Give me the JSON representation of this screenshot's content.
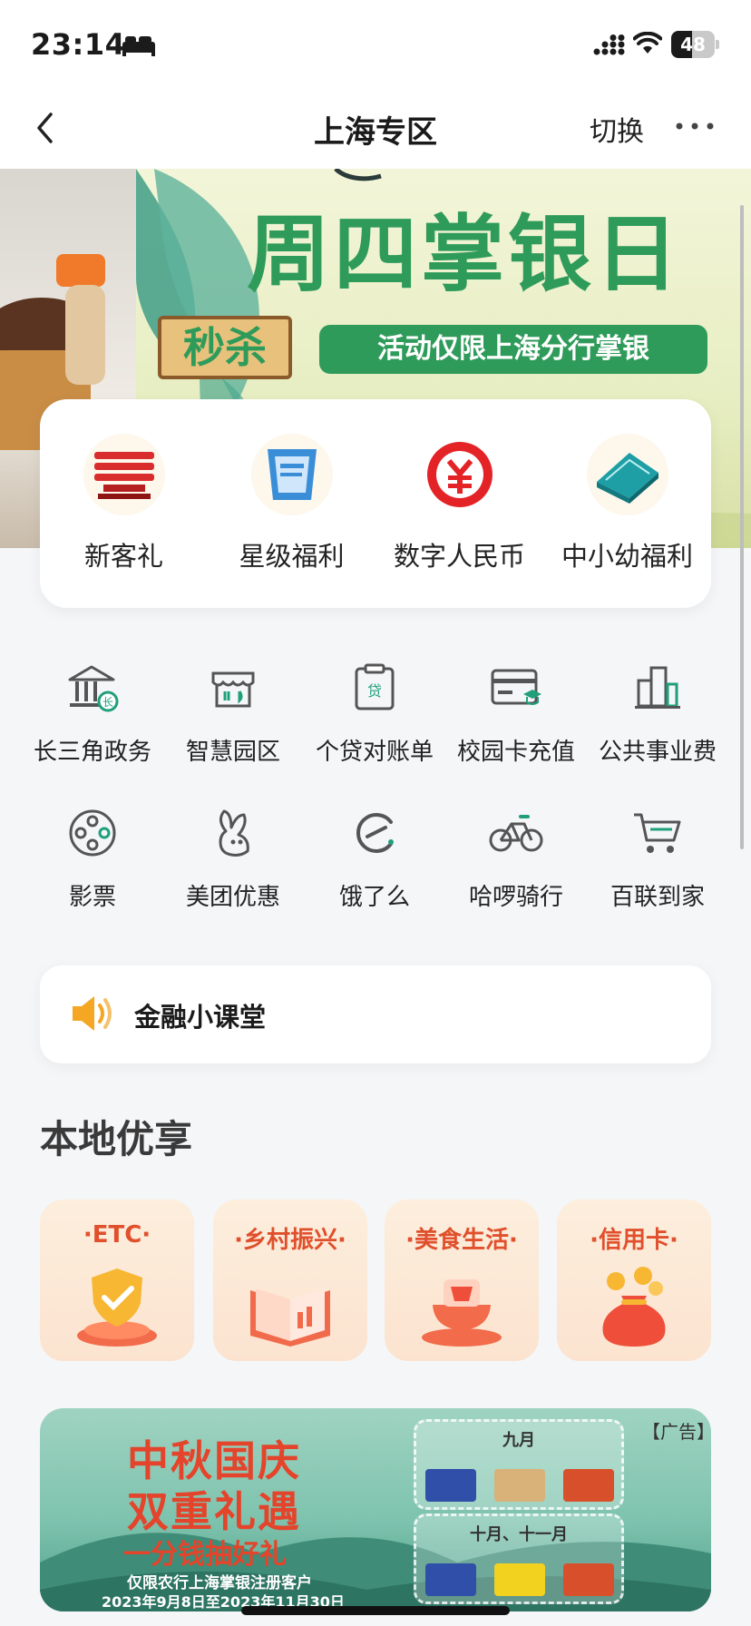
{
  "status_bar": {
    "time": "23:14",
    "battery": "48",
    "battery_level": 0.48
  },
  "nav": {
    "title": "上海专区",
    "switch_label": "切换"
  },
  "banner": {
    "headline": "周四掌银日",
    "tag_left": "秒杀",
    "tag_right": "活动仅限上海分行掌银"
  },
  "featured": [
    {
      "label": "新客礼",
      "icon": "red-building-icon"
    },
    {
      "label": "星级福利",
      "icon": "blue-card-icon"
    },
    {
      "label": "数字人民币",
      "icon": "digital-yuan-icon"
    },
    {
      "label": "中小幼福利",
      "icon": "teal-building-icon"
    }
  ],
  "services": [
    {
      "label": "长三角政务",
      "icon": "government-icon"
    },
    {
      "label": "智慧园区",
      "icon": "store-icon"
    },
    {
      "label": "个贷对账单",
      "icon": "loan-clipboard-icon"
    },
    {
      "label": "校园卡充值",
      "icon": "campus-card-icon"
    },
    {
      "label": "公共事业费",
      "icon": "utilities-building-icon"
    },
    {
      "label": "影票",
      "icon": "film-reel-icon"
    },
    {
      "label": "美团优惠",
      "icon": "kangaroo-icon"
    },
    {
      "label": "饿了么",
      "icon": "eleme-icon"
    },
    {
      "label": "哈啰骑行",
      "icon": "bicycle-icon"
    },
    {
      "label": "百联到家",
      "icon": "cart-icon"
    }
  ],
  "finance": {
    "label": "金融小课堂"
  },
  "local": {
    "title": "本地优享",
    "items": [
      {
        "label": "·ETC·"
      },
      {
        "label": "·乡村振兴·"
      },
      {
        "label": "·美食生活·"
      },
      {
        "label": "·信用卡·"
      }
    ]
  },
  "ad": {
    "tag": "【广告】",
    "title_line1": "中秋国庆",
    "title_line2": "双重礼遇",
    "subtitle": "一分钱抽好礼",
    "note_line1": "仅限农行上海掌银注册客户",
    "note_line2": "2023年9月8日至2023年11月30日",
    "box1_label": "九月",
    "box2_label": "十月、十一月"
  },
  "colors": {
    "accent_green": "#2f9b5a",
    "ad_red": "#e4442b",
    "local_red": "#e0502c"
  }
}
